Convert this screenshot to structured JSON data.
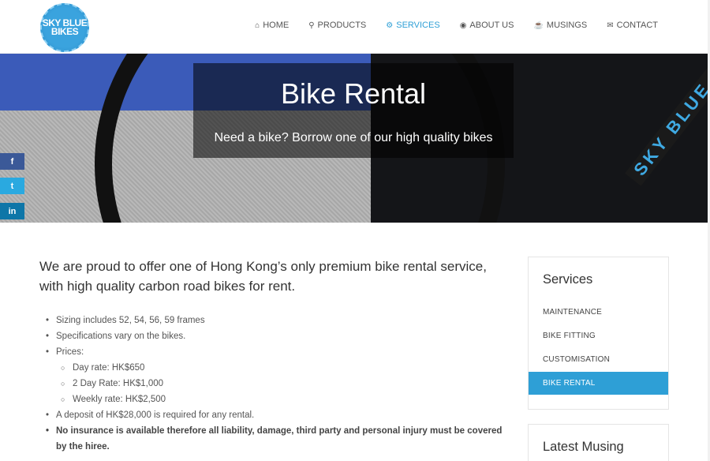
{
  "logo": {
    "line1": "SKY BLUE",
    "line2": "BIKES"
  },
  "nav": [
    {
      "label": "HOME",
      "icon": "⌂",
      "active": false
    },
    {
      "label": "PRODUCTS",
      "icon": "⚲",
      "active": false
    },
    {
      "label": "SERVICES",
      "icon": "⚙",
      "active": true
    },
    {
      "label": "ABOUT US",
      "icon": "◉",
      "active": false
    },
    {
      "label": "MUSINGS",
      "icon": "☕",
      "active": false
    },
    {
      "label": "CONTACT",
      "icon": "✉",
      "active": false
    }
  ],
  "hero": {
    "title": "Bike Rental",
    "subtitle": "Need a bike? Borrow one of our high quality bikes",
    "frame_text": "SKY BLUE BI"
  },
  "social": {
    "facebook": "f",
    "twitter": "t",
    "linkedin": "in"
  },
  "content": {
    "lead": "We are proud to offer one of Hong Kong’s only premium bike rental service, with high quality carbon road bikes for rent.",
    "items": [
      "Sizing includes 52, 54, 56, 59 frames",
      "Specifications vary on the bikes.",
      "Prices:"
    ],
    "prices": [
      "Day rate: HK$650",
      "2 Day Rate: HK$1,000",
      "Weekly rate: HK$2,500"
    ],
    "deposit": "A deposit of HK$28,000 is required for any rental.",
    "insurance": "No insurance is available therefore all liability, damage, third party and personal injury must be covered by the hiree."
  },
  "sidebar": {
    "title": "Services",
    "links": [
      "MAINTENANCE",
      "BIKE FITTING",
      "CUSTOMISATION",
      "BIKE RENTAL"
    ],
    "active_index": 3,
    "latest_title": "Latest Musing"
  },
  "colors": {
    "accent": "#2e9fd6",
    "facebook": "#3b5998",
    "twitter": "#2aa9e0",
    "linkedin": "#0e76a8"
  }
}
